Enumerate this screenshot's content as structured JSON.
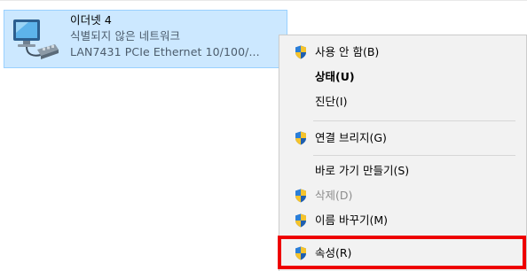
{
  "adapter": {
    "name": "이더넷 4",
    "status": "식별되지 않은 네트워크",
    "device": "LAN7431 PCIe Ethernet 10/100/..."
  },
  "context_menu": {
    "items": [
      {
        "label": "사용 안 함(B)",
        "icon": "shield-icon",
        "bold": false,
        "disabled": false
      },
      {
        "label": "상태(U)",
        "icon": null,
        "bold": true,
        "disabled": false
      },
      {
        "label": "진단(I)",
        "icon": null,
        "bold": false,
        "disabled": false
      },
      {
        "label": "연결 브리지(G)",
        "icon": "shield-icon",
        "bold": false,
        "disabled": false
      },
      {
        "label": "바로 가기 만들기(S)",
        "icon": null,
        "bold": false,
        "disabled": false
      },
      {
        "label": "삭제(D)",
        "icon": "shield-icon",
        "bold": false,
        "disabled": true
      },
      {
        "label": "이름 바꾸기(M)",
        "icon": "shield-icon",
        "bold": false,
        "disabled": false
      },
      {
        "label": "속성(R)",
        "icon": "shield-icon",
        "bold": false,
        "disabled": false,
        "highlighted": true
      }
    ]
  },
  "colors": {
    "selection_bg": "#cce8ff",
    "menu_bg": "#f2f2f2",
    "highlight_border": "#ee0000",
    "disabled_text": "#8d8d8d"
  }
}
